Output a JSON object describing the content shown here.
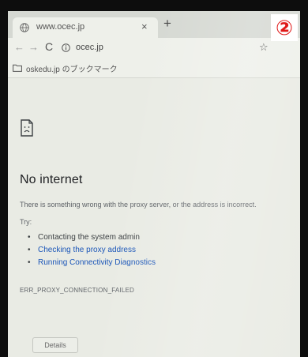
{
  "browser": {
    "tab_title": "www.ocec.jp",
    "tab_close": "×",
    "new_tab": "+",
    "url": "ocec.jp",
    "bookmark_folder": "oskedu.jp のブックマーク"
  },
  "annotation": {
    "marker": "②",
    "color": "#e01818"
  },
  "error_page": {
    "title": "No internet",
    "description": "There is something wrong with the proxy server, or the address is incorrect.",
    "try_label": "Try:",
    "suggestions": [
      {
        "text": "Contacting the system admin",
        "is_link": false
      },
      {
        "text": "Checking the proxy address",
        "is_link": true
      },
      {
        "text": "Running Connectivity Diagnostics",
        "is_link": true
      }
    ],
    "error_code": "ERR_PROXY_CONNECTION_FAILED",
    "details_label": "Details"
  },
  "colors": {
    "link": "#1a55b8",
    "background": "#e9ebe4"
  },
  "icons": [
    "globe-icon",
    "info-icon",
    "folder-icon",
    "sad-page-icon",
    "star-icon",
    "reload-icon",
    "back-arrow-icon",
    "forward-arrow-icon"
  ]
}
